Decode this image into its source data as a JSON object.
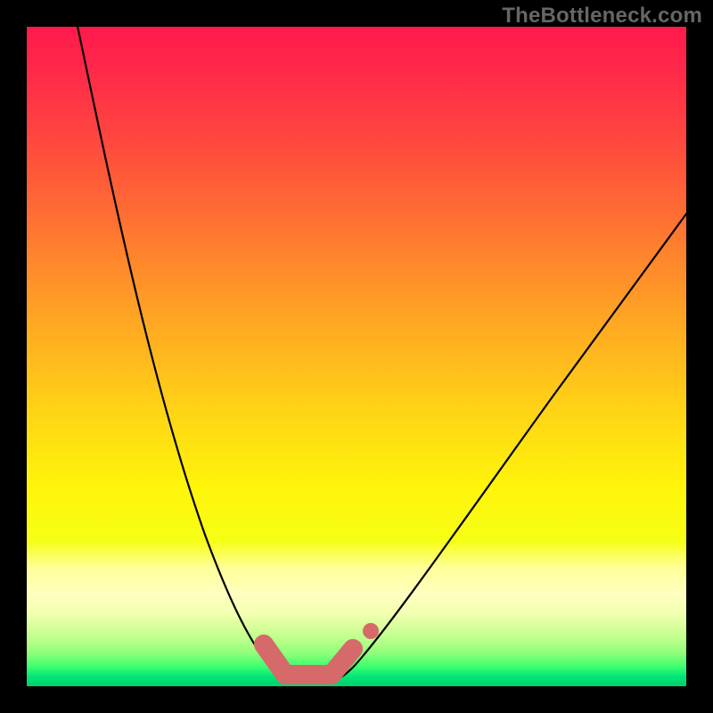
{
  "watermark": "TheBottleneck.com",
  "chart_data": {
    "type": "line",
    "title": "",
    "xlabel": "",
    "ylabel": "",
    "xlim": [
      0,
      100
    ],
    "ylim": [
      0,
      100
    ],
    "background_gradient": {
      "direction": "vertical",
      "stops": [
        {
          "pos": 0,
          "color": "#ff1a4b"
        },
        {
          "pos": 50,
          "color": "#ffd316"
        },
        {
          "pos": 80,
          "color": "#ffff99"
        },
        {
          "pos": 100,
          "color": "#00d26a"
        }
      ]
    },
    "series": [
      {
        "name": "left-branch",
        "x": [
          7,
          12,
          18,
          24,
          30,
          36,
          40
        ],
        "y": [
          100,
          72,
          45,
          25,
          12,
          4,
          1
        ]
      },
      {
        "name": "right-branch",
        "x": [
          46,
          52,
          60,
          70,
          82,
          94,
          100
        ],
        "y": [
          1,
          5,
          15,
          32,
          51,
          66,
          72
        ]
      }
    ],
    "markers": {
      "u_stroke_xy": [
        [
          36,
          6
        ],
        [
          39,
          1.5
        ],
        [
          46,
          1.5
        ],
        [
          49,
          6
        ]
      ],
      "dot_xy": [
        52,
        8
      ],
      "color": "#d66a6a"
    },
    "grid": false,
    "legend": false
  }
}
